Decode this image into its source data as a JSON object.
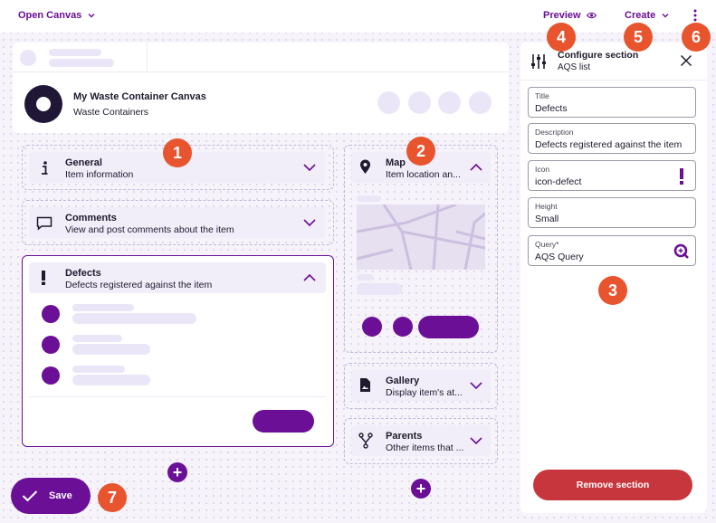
{
  "topbar": {
    "open_canvas": "Open Canvas",
    "preview": "Preview",
    "create": "Create"
  },
  "badges": [
    "1",
    "2",
    "3",
    "4",
    "5",
    "6",
    "7"
  ],
  "canvas": {
    "title": "My Waste Container Canvas",
    "subtitle": "Waste Containers"
  },
  "sections": {
    "general": {
      "title": "General",
      "sub": "Item information",
      "icon": "info-icon"
    },
    "comments": {
      "title": "Comments",
      "sub": "View and post comments about the item",
      "icon": "comment-icon"
    },
    "defects": {
      "title": "Defects",
      "sub": "Defects registered against the item",
      "icon": "exclamation-icon"
    },
    "map": {
      "title": "Map",
      "sub": "Item location an...",
      "icon": "location-pin-icon"
    },
    "gallery": {
      "title": "Gallery",
      "sub": "Display item's at...",
      "icon": "image-icon"
    },
    "parents": {
      "title": "Parents",
      "sub": "Other items that ...",
      "icon": "hierarchy-icon"
    }
  },
  "save": {
    "label": "Save"
  },
  "panel": {
    "title": "Configure section",
    "subtitle": "AQS list",
    "fields": [
      {
        "label": "Title",
        "value": "Defects"
      },
      {
        "label": "Description",
        "value": "Defects registered against the item"
      },
      {
        "label": "Icon",
        "value": "icon-defect"
      },
      {
        "label": "Height",
        "value": "Small"
      },
      {
        "label": "Query*",
        "value": "AQS Query"
      }
    ],
    "remove": "Remove section"
  },
  "colors": {
    "primary": "#6a0f96",
    "badge": "#e8542e",
    "danger": "#c8363d",
    "placeholder": "#ebe6f7"
  }
}
